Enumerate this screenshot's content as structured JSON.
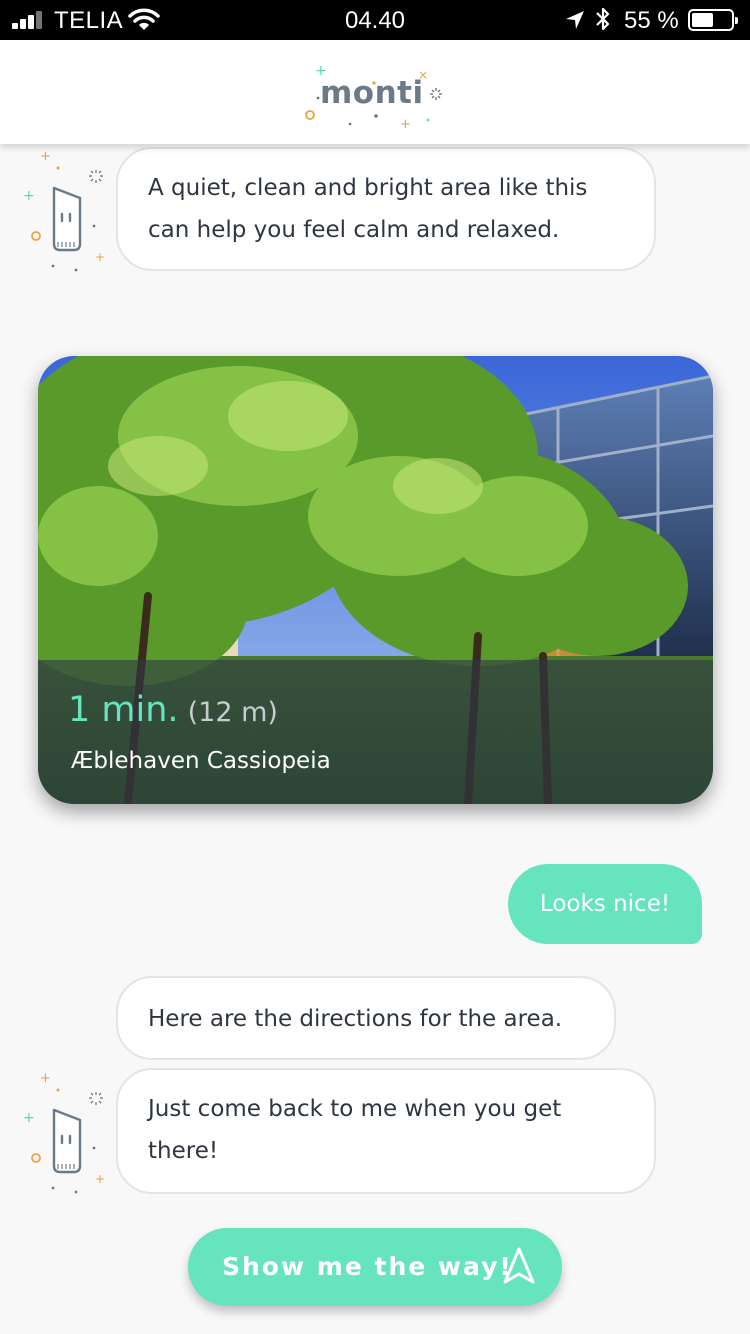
{
  "status_bar": {
    "carrier": "TELIA",
    "time": "04.40",
    "battery": "55 %",
    "battery_level": 0.55,
    "icons": [
      "signal-icon",
      "wifi-icon",
      "location-arrow-icon",
      "bluetooth-icon",
      "battery-icon"
    ]
  },
  "header": {
    "logo": "monti"
  },
  "chat": {
    "bot_message_1": {
      "line1": "A quiet, clean and bright area like this",
      "line2": "can help you feel calm and relaxed."
    },
    "place_card": {
      "duration": "1 min.",
      "distance": "(12 m)",
      "name": "Æblehaven Cassiopeia"
    },
    "user_message": "Looks nice!",
    "bot_message_2": "Here are the directions for the area.",
    "bot_message_3": {
      "line1": "Just come back to me when you get",
      "line2": "there!"
    }
  },
  "actions": {
    "show_way": "Show me the way!"
  },
  "colors": {
    "accent": "#66e4bd",
    "text": "#2f3640",
    "background": "#f8f8f8",
    "logo_gray": "#6b7a88",
    "sparkle_orange": "#f0a040",
    "sparkle_teal": "#5dd6b2"
  }
}
